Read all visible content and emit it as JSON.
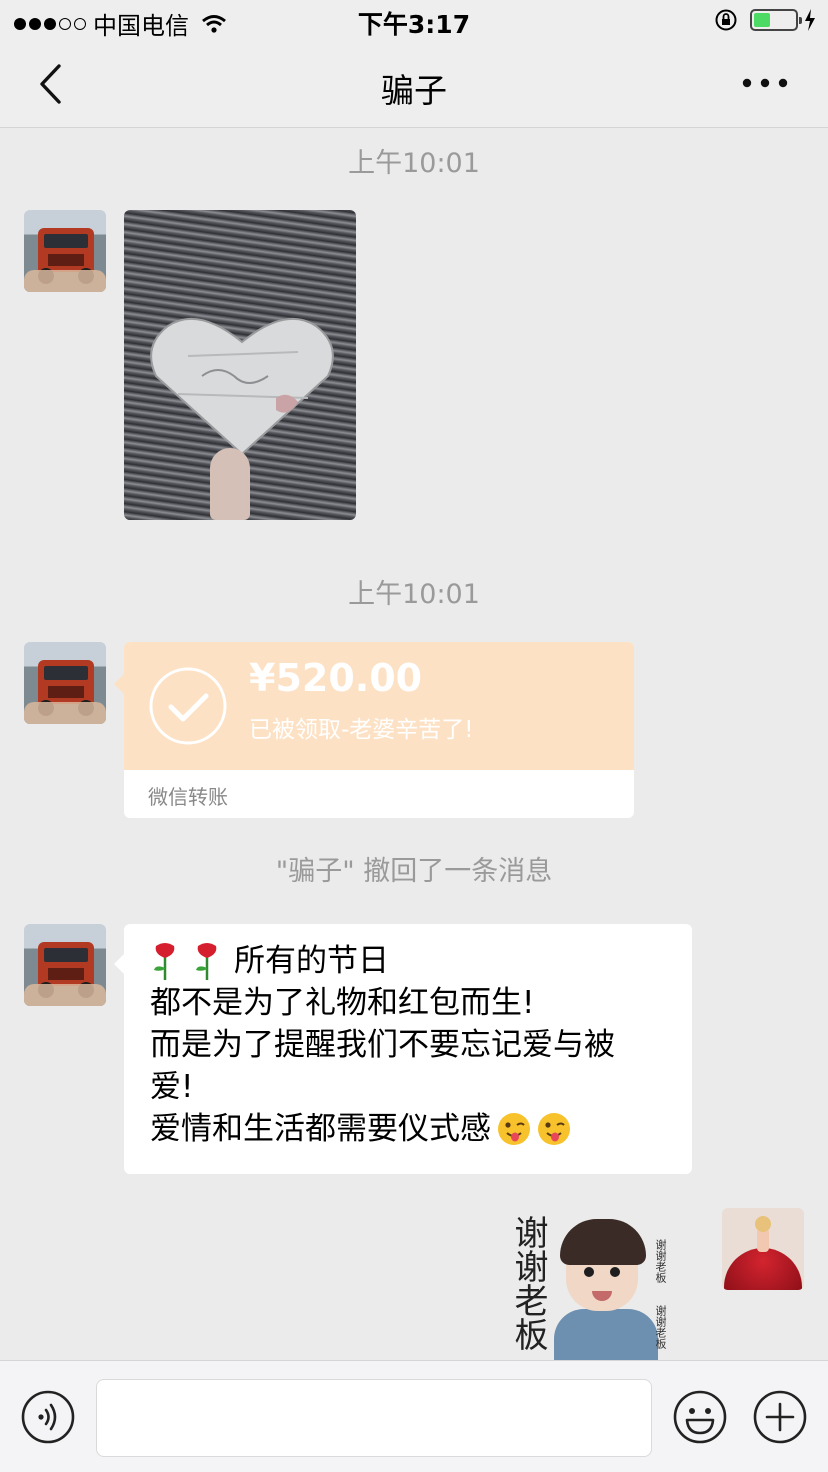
{
  "status_bar": {
    "signal_filled": 3,
    "signal_total": 5,
    "carrier": "中国电信",
    "time": "下午3:17",
    "battery_level": 0.4
  },
  "nav": {
    "title": "骗子",
    "back_icon": "chevron-left-icon",
    "more_icon": "more-dots-icon"
  },
  "chat": {
    "time_1": "上午10:01",
    "time_2": "上午10:01",
    "transfer": {
      "amount": "¥520.00",
      "status": "已被领取-老婆辛苦了!",
      "footer": "微信转账",
      "bg_color": "#fde1c4"
    },
    "recall_notice": "\"骗子\" 撤回了一条消息",
    "text_message": {
      "line_1": "所有的节日",
      "line_2": "都不是为了礼物和红包而生!",
      "line_3": "而是为了提醒我们不要忘记爱与被",
      "line_4": "爱!",
      "line_5": "爱情和生活都需要仪式感"
    },
    "sticker": {
      "big_text": "谢谢老板",
      "side_text": "谢谢老板"
    }
  },
  "input_bar": {
    "value": "",
    "voice_icon": "voice-icon",
    "emoji_icon": "emoji-icon",
    "plus_icon": "plus-icon"
  },
  "colors": {
    "background": "#ebebeb",
    "bar": "#eeeeee",
    "muted_text": "#9a9a9a"
  }
}
